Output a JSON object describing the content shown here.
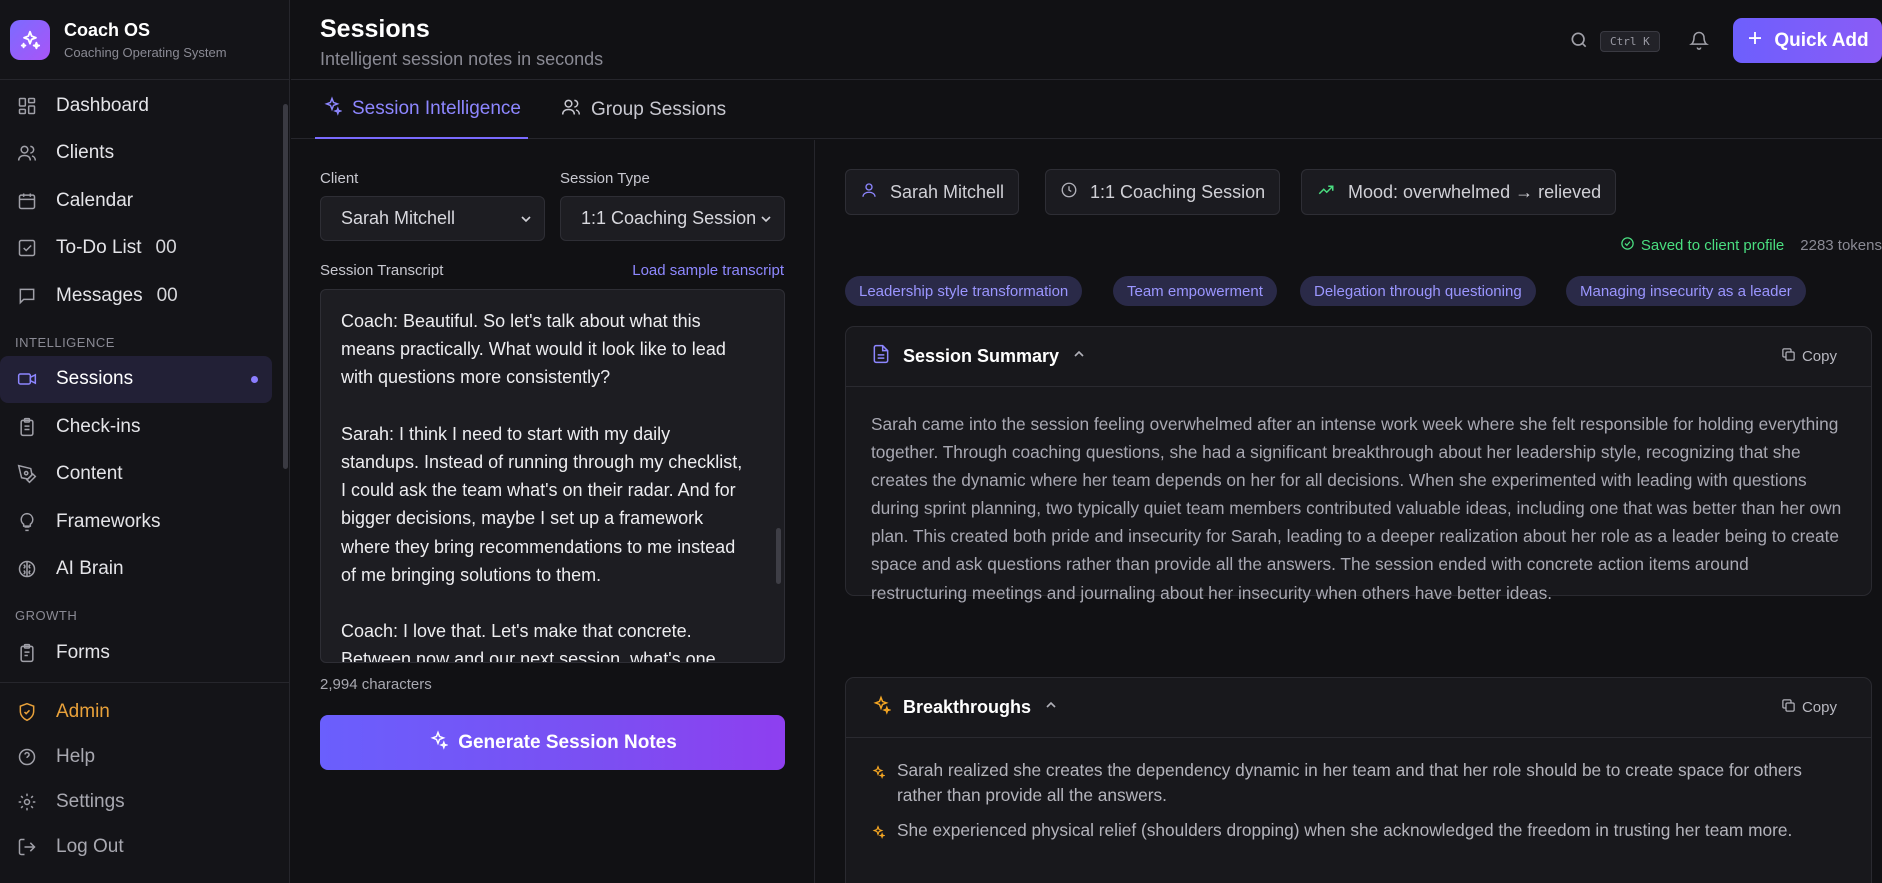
{
  "brand": {
    "name": "Coach OS",
    "subtitle": "Coaching Operating System"
  },
  "nav": {
    "dashboard": "Dashboard",
    "clients": "Clients",
    "calendar": "Calendar",
    "todo": "To-Do List",
    "todo_badge": "00",
    "messages": "Messages",
    "messages_badge": "00",
    "section_intelligence": "INTELLIGENCE",
    "sessions": "Sessions",
    "checkins": "Check-ins",
    "content": "Content",
    "frameworks": "Frameworks",
    "ai_brain": "AI Brain",
    "section_growth": "GROWTH",
    "forms": "Forms"
  },
  "bottom_nav": {
    "admin": "Admin",
    "help": "Help",
    "settings": "Settings",
    "logout": "Log Out"
  },
  "header": {
    "title": "Sessions",
    "subtitle": "Intelligent session notes in seconds",
    "shortcut": "Ctrl K",
    "quick_add": "Quick Add"
  },
  "tabs": {
    "intelligence": "Session Intelligence",
    "group": "Group Sessions"
  },
  "form": {
    "client_label": "Client",
    "client_value": "Sarah Mitchell",
    "type_label": "Session Type",
    "type_value": "1:1 Coaching Session",
    "transcript_label": "Session Transcript",
    "load_sample": "Load sample transcript",
    "transcript": "Coach: Beautiful. So let's talk about what this means practically. What would it look like to lead with questions more consistently?\n\nSarah: I think I need to start with my daily standups. Instead of running through my checklist, I could ask the team what's on their radar. And for bigger decisions, maybe I set up a framework where they bring recommendations to me instead of me bringing solutions to them.\n\nCoach: I love that. Let's make that concrete. Between now and our next session, what's one",
    "char_count": "2,994 characters",
    "generate": "Generate Session Notes"
  },
  "output": {
    "client_chip": "Sarah Mitchell",
    "type_chip": "1:1 Coaching Session",
    "mood_chip": "Mood: overwhelmed → relieved",
    "saved": "Saved to client profile",
    "tokens": "2283 tokens",
    "tags": [
      "Leadership style transformation",
      "Team empowerment",
      "Delegation through questioning",
      "Managing insecurity as a leader"
    ],
    "summary_title": "Session Summary",
    "copy": "Copy",
    "summary": "Sarah came into the session feeling overwhelmed after an intense work week where she felt responsible for holding everything together. Through coaching questions, she had a significant breakthrough about her leadership style, recognizing that she creates the dynamic where her team depends on her for all decisions. When she experimented with leading with questions during sprint planning, two typically quiet team members contributed valuable ideas, including one that was better than her own plan. This created both pride and insecurity for Sarah, leading to a deeper realization about her role as a leader being to create space and ask questions rather than provide all the answers. The session ended with concrete action items around restructuring meetings and journaling about her insecurity when others have better ideas.",
    "breakthroughs_title": "Breakthroughs",
    "breakthroughs": [
      "Sarah realized she creates the dependency dynamic in her team and that her role should be to create space for others rather than provide all the answers.",
      "She experienced physical relief (shoulders dropping) when she acknowledged the freedom in trusting her team more."
    ]
  },
  "colors": {
    "accent": "#7a6bff",
    "admin": "#e8a13a",
    "success": "#4ade80"
  }
}
